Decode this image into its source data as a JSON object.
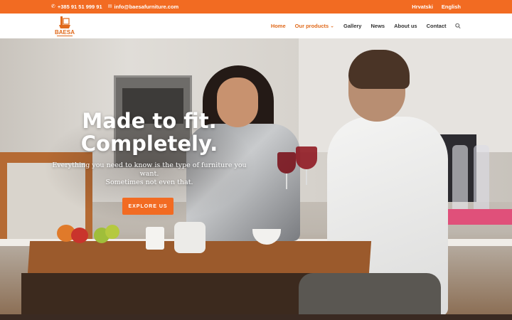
{
  "topbar": {
    "phone": "+385 91 51 999 91",
    "email": "info@baesafurniture.com",
    "languages": [
      "Hrvatski",
      "English"
    ],
    "background": "#f26b22"
  },
  "header": {
    "logo_text": "BAESA",
    "nav": [
      {
        "label": "Home",
        "active": true
      },
      {
        "label": "Our products",
        "dropdown": true
      },
      {
        "label": "Gallery"
      },
      {
        "label": "News"
      },
      {
        "label": "About us"
      },
      {
        "label": "Contact"
      }
    ],
    "search_icon": "search-icon"
  },
  "hero": {
    "headline_line1": "Made to fit.",
    "headline_line2": "Completely.",
    "subtitle_line1": "Everything you need to know is the type of furniture you",
    "subtitle_line2": "want.",
    "subtitle_line3": "Sometimes not even that.",
    "cta_label": "EXPLORE US"
  },
  "colors": {
    "accent": "#f26b22",
    "active_nav": "#e06a1c"
  }
}
